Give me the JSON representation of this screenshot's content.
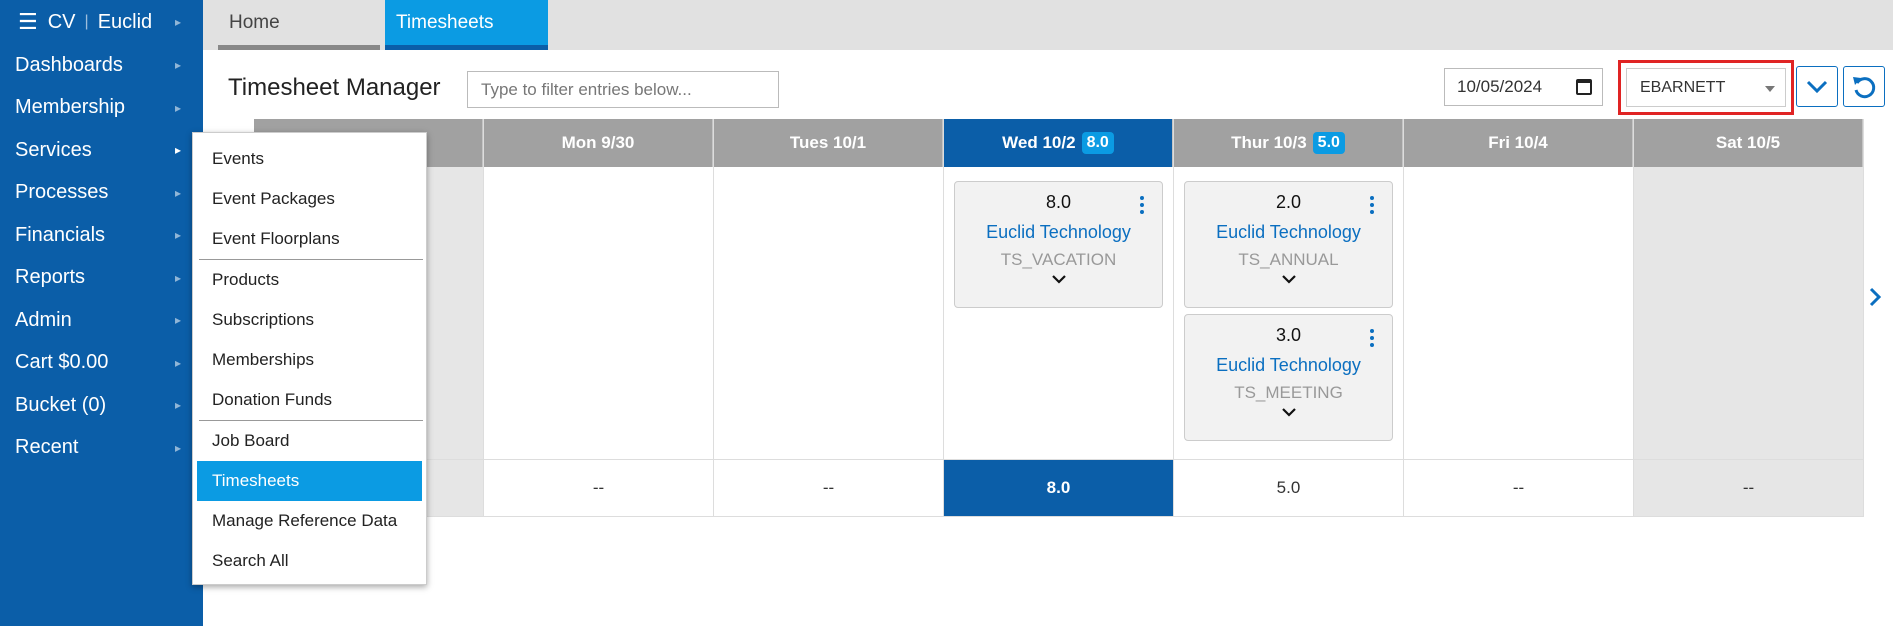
{
  "brand": {
    "menu_icon": "hamburger-icon",
    "left": "CV",
    "separator": "|",
    "right": "Euclid"
  },
  "nav": [
    {
      "label": "Dashboards"
    },
    {
      "label": "Membership"
    },
    {
      "label": "Services"
    },
    {
      "label": "Processes"
    },
    {
      "label": "Financials"
    },
    {
      "label": "Reports"
    },
    {
      "label": "Admin"
    },
    {
      "label": "Cart $0.00"
    },
    {
      "label": "Bucket (0)"
    },
    {
      "label": "Recent"
    }
  ],
  "submenu": {
    "group1": [
      "Events",
      "Event Packages",
      "Event Floorplans"
    ],
    "group2": [
      "Products",
      "Subscriptions",
      "Memberships",
      "Donation Funds"
    ],
    "group3": [
      "Job Board",
      "Timesheets",
      "Manage Reference Data",
      "Search All"
    ],
    "active": "Timesheets"
  },
  "tabs": {
    "home": "Home",
    "timesheets": "Timesheets"
  },
  "header": {
    "title": "Timesheet Manager",
    "filter_placeholder": "Type to filter entries below...",
    "date": "10/05/2024",
    "user": "EBARNETT"
  },
  "grid": {
    "columns": [
      {
        "label": "",
        "total": ""
      },
      {
        "label": "Mon 9/30",
        "total": "--"
      },
      {
        "label": "Tues 10/1",
        "total": "--"
      },
      {
        "label": "Wed 10/2",
        "badge": "8.0",
        "total": "8.0"
      },
      {
        "label": "Thur 10/3",
        "badge": "5.0",
        "total": "5.0"
      },
      {
        "label": "Fri 10/4",
        "total": "--"
      },
      {
        "label": "Sat 10/5",
        "total": "--"
      }
    ],
    "entries": {
      "wed": [
        {
          "hours": "8.0",
          "org": "Euclid Technology",
          "code": "TS_VACATION"
        }
      ],
      "thur": [
        {
          "hours": "2.0",
          "org": "Euclid Technology",
          "code": "TS_ANNUAL"
        },
        {
          "hours": "3.0",
          "org": "Euclid Technology",
          "code": "TS_MEETING"
        }
      ]
    }
  },
  "colors": {
    "sidebar": "#0b5ea8",
    "accent": "#0b9be3",
    "header_gray": "#a1a1a1",
    "highlight_red": "#e02424",
    "link": "#0b6fc0"
  }
}
